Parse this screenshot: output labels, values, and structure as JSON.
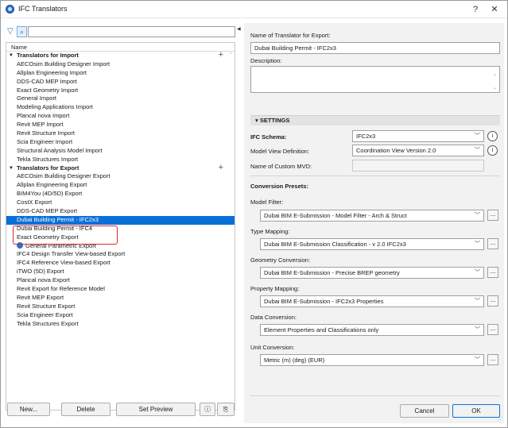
{
  "window": {
    "title": "IFC Translators",
    "help": "?",
    "close": "✕"
  },
  "left": {
    "search_placeholder": "",
    "column_header": "Name",
    "groups": [
      {
        "label": "Translators for Import",
        "items": [
          "AECOsim Building Designer Import",
          "Allplan Engineering Import",
          "DDS-CAD MEP Import",
          "Exact Geometry Import",
          "General Import",
          "Modeling Applications Import",
          "Plancal nova Import",
          "Revit MEP Import",
          "Revit Structure Import",
          "Scia Engineer Import",
          "Structural Analysis Model Import",
          "Tekla Structures Import"
        ]
      },
      {
        "label": "Translators for Export",
        "items": [
          "AECOsim Building Designer Export",
          "Allplan Engineering Export",
          "BIM4You (4D/5D) Export",
          "CostX Export",
          "DDS-CAD MEP Export",
          "Dubai Building Permit - IFC2x3",
          "Dubai Building Permit - IFC4",
          "Exact Geometry Export",
          "General Parametric Export",
          "IFC4 Design Transfer View-based Export",
          "IFC4 Reference View-based Export",
          "iTWO (5D) Export",
          "Plancal nova Export",
          "Revit Export for Reference Model",
          "Revit MEP Export",
          "Revit Structure Export",
          "Scia Engineer Export",
          "Tekla Structures Export"
        ]
      }
    ],
    "selected_item": "Dubai Building Permit - IFC2x3",
    "buttons": {
      "new": "New...",
      "delete": "Delete",
      "set_preview": "Set Preview"
    }
  },
  "right": {
    "name_label": "Name of Translator for Export:",
    "name_value": "Dubai Building Permit - IFC2x3",
    "description_label": "Description:",
    "settings_header": "SETTINGS",
    "ifc_schema_label": "IFC Schema:",
    "ifc_schema_value": "IFC2x3",
    "mvd_label": "Model View Definition:",
    "mvd_value": "Coordination View Version 2.0",
    "custom_mvd_label": "Name of Custom MVD:",
    "presets_label": "Conversion Presets:",
    "model_filter_label": "Model Filter:",
    "model_filter_value": "Dubai BIM E-Submission - Model Filter - Arch & Struct",
    "type_mapping_label": "Type Mapping:",
    "type_mapping_value": "Dubai BIM E-Submission Classification - v 2.0 IFC2x3",
    "geometry_label": "Geometry Conversion:",
    "geometry_value": "Dubai BIM E-Submission - Precise BREP geometry",
    "property_label": "Property Mapping:",
    "property_value": "Dubai BIM E-Submission - IFC2x3 Properties",
    "data_label": "Data Conversion:",
    "data_value": "Element Properties and Classifications only",
    "unit_label": "Unit Conversion:",
    "unit_value": "Metric (m) (deg) (EUR)",
    "cancel": "Cancel",
    "ok": "OK"
  },
  "colors": {
    "selection": "#0b6fd8",
    "highlight_box": "#e0262b"
  }
}
